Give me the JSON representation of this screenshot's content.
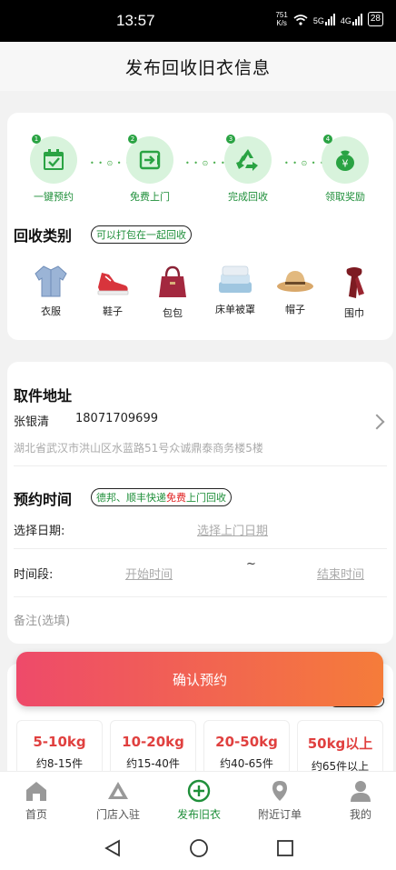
{
  "status_bar": {
    "time": "13:57",
    "net_speed_value": "751",
    "net_speed_unit": "K/s",
    "battery": "28",
    "sig1": "5G",
    "sig2": "4G"
  },
  "header": {
    "title": "发布回收旧衣信息"
  },
  "steps": [
    {
      "num": "1",
      "label": "一键预约",
      "icon": "calendar-check-icon"
    },
    {
      "num": "2",
      "label": "免费上门",
      "icon": "truck-icon"
    },
    {
      "num": "3",
      "label": "完成回收",
      "icon": "recycle-icon"
    },
    {
      "num": "4",
      "label": "领取奖励",
      "icon": "yuan-reward-icon"
    }
  ],
  "step_separator": "• • ⊙ • •",
  "category": {
    "title": "回收类别",
    "tag": "可以打包在一起回收",
    "items": [
      {
        "label": "衣服",
        "icon": "jacket-icon"
      },
      {
        "label": "鞋子",
        "icon": "sneaker-icon"
      },
      {
        "label": "包包",
        "icon": "handbag-icon"
      },
      {
        "label": "床单被罩",
        "icon": "bedsheet-icon"
      },
      {
        "label": "帽子",
        "icon": "hat-icon"
      },
      {
        "label": "围巾",
        "icon": "scarf-icon"
      }
    ]
  },
  "address": {
    "title": "取件地址",
    "name": "张银清",
    "phone": "18071709699",
    "detail": "湖北省武汉市洪山区水蓝路51号众诚鼎泰商务楼5楼"
  },
  "appointment": {
    "title": "预约时间",
    "tag_before": "德邦、顺丰快递",
    "tag_highlight": "免费",
    "tag_after": "上门回收",
    "date_label": "选择日期:",
    "date_placeholder": "选择上门日期",
    "period_label": "时间段:",
    "start_placeholder": "开始时间",
    "separator": "~",
    "end_placeholder": "结束时间",
    "remark_placeholder": "备注(选填)"
  },
  "confirm_button": "确认预约",
  "weight_options": [
    {
      "range": "5-10kg",
      "count": "约8-15件"
    },
    {
      "range": "10-20kg",
      "count": "约15-40件"
    },
    {
      "range": "20-50kg",
      "count": "约40-65件"
    },
    {
      "range": "50kg以上",
      "count": "约65件以上"
    }
  ],
  "bottom_nav": [
    {
      "label": "首页",
      "icon": "home-icon"
    },
    {
      "label": "门店入驻",
      "icon": "store-icon"
    },
    {
      "label": "发布旧衣",
      "icon": "add-circle-icon",
      "active": true
    },
    {
      "label": "附近订单",
      "icon": "location-icon"
    },
    {
      "label": "我的",
      "icon": "user-icon"
    }
  ],
  "colors": {
    "accent_green": "#1f8f3a",
    "step_bg": "#d8f3dc",
    "button_start": "#ee4a6a",
    "button_end": "#f57c3a",
    "weight_red": "#e0403f"
  }
}
